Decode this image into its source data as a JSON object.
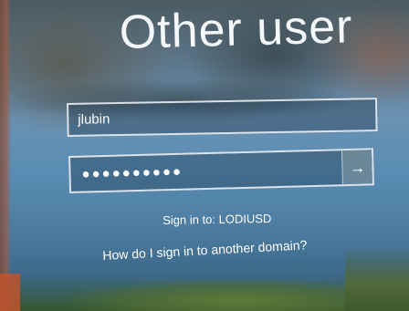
{
  "title": "Other user",
  "username_field": {
    "value": "jlubin"
  },
  "password_field": {
    "masked_value": "●●●●●●●●●●",
    "submit_icon": "arrow-right-icon",
    "submit_glyph": "→"
  },
  "sign_in_to": "Sign in to: LODIUSD",
  "other_domain_link": "How do I sign in to another domain?",
  "colors": {
    "text": "#ffffff",
    "field_border": "#ebf0f5",
    "submit_bg": "#7891a0"
  }
}
